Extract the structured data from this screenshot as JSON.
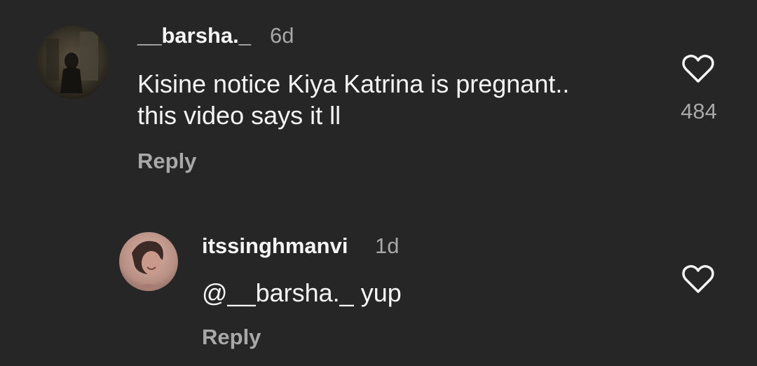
{
  "comments": [
    {
      "username": "__barsha._",
      "time": "6d",
      "text_lines": [
        "Kisine notice Kiya Katrina is pregnant..",
        "this video says it ll"
      ],
      "reply_label": "Reply",
      "like_count": "484",
      "like_icon": "heart-outline-icon"
    },
    {
      "username": "itssinghmanvi",
      "time": "1d",
      "text": "@__barsha._ yup",
      "reply_label": "Reply",
      "like_icon": "heart-outline-icon"
    }
  ],
  "colors": {
    "background": "#262626",
    "primary_text": "#f5f5f5",
    "secondary_text": "#a8a8a8"
  }
}
